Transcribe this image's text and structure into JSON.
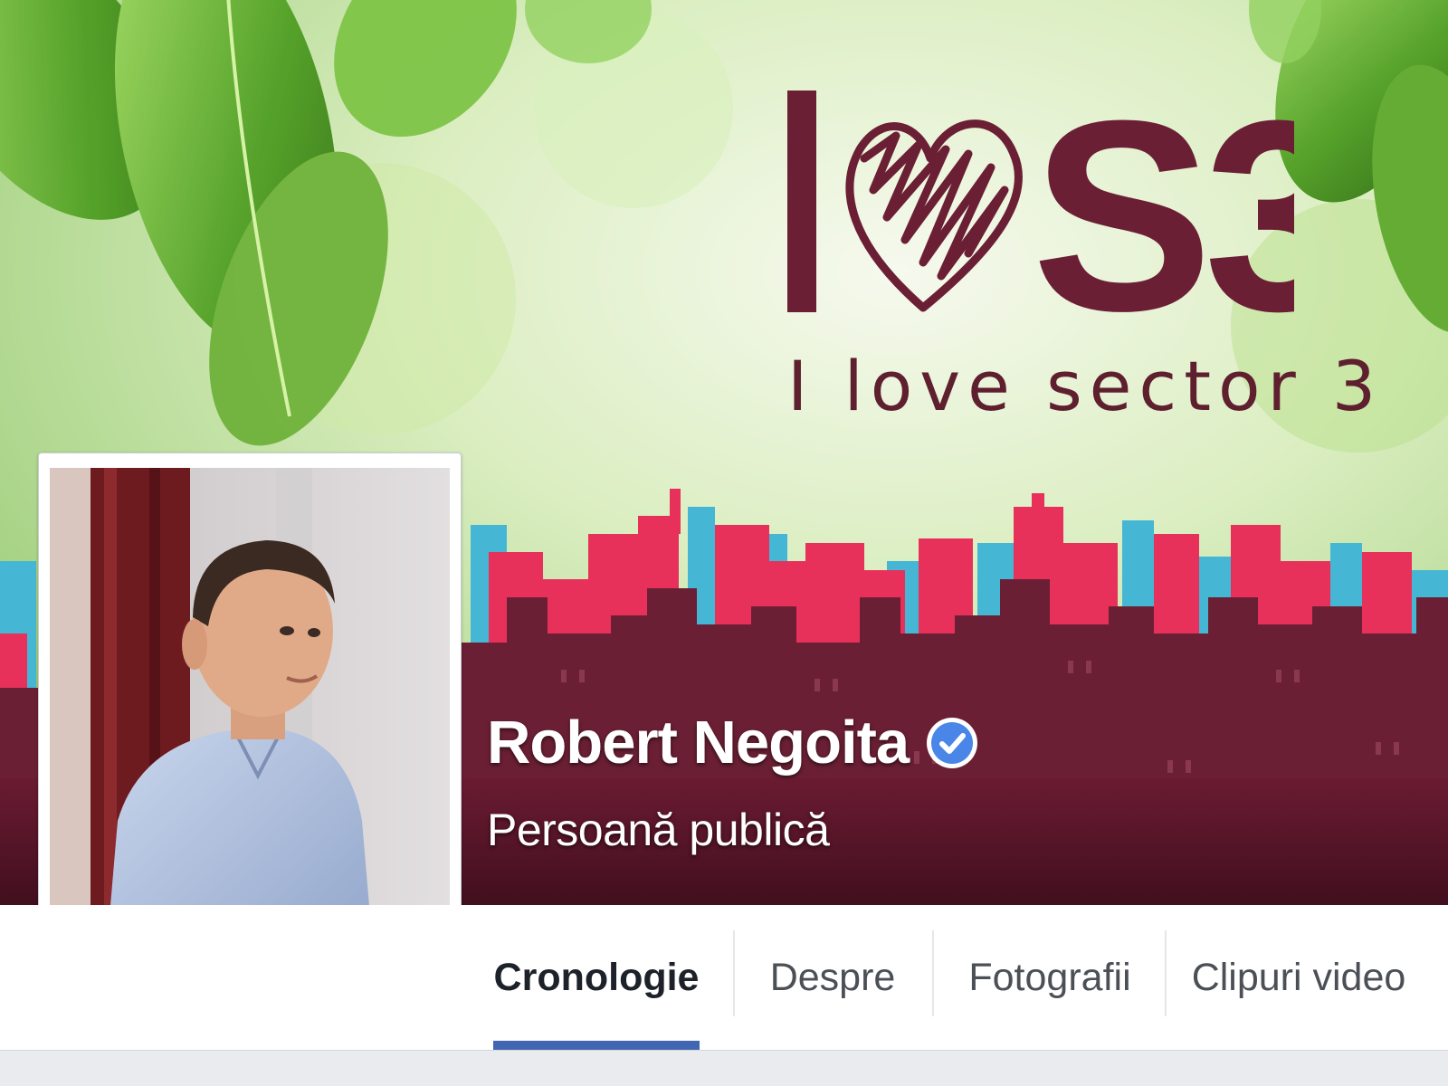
{
  "cover": {
    "logo_text": "I ♥ S3",
    "tagline": "I love sector 3"
  },
  "profile": {
    "name": "Robert Negoita",
    "verified": true,
    "category": "Persoană publică"
  },
  "tabs": [
    {
      "label": "Cronologie",
      "active": true
    },
    {
      "label": "Despre",
      "active": false
    },
    {
      "label": "Fotografii",
      "active": false
    },
    {
      "label": "Clipuri video",
      "active": false
    }
  ],
  "colors": {
    "brand_maroon": "#6b1f34",
    "skyline_red": "#e8315a",
    "skyline_cyan": "#45b6d4",
    "tab_underline": "#4267b2",
    "verified_blue": "#4a86e8"
  },
  "icons": [
    "heart-icon",
    "verified-badge-icon"
  ]
}
